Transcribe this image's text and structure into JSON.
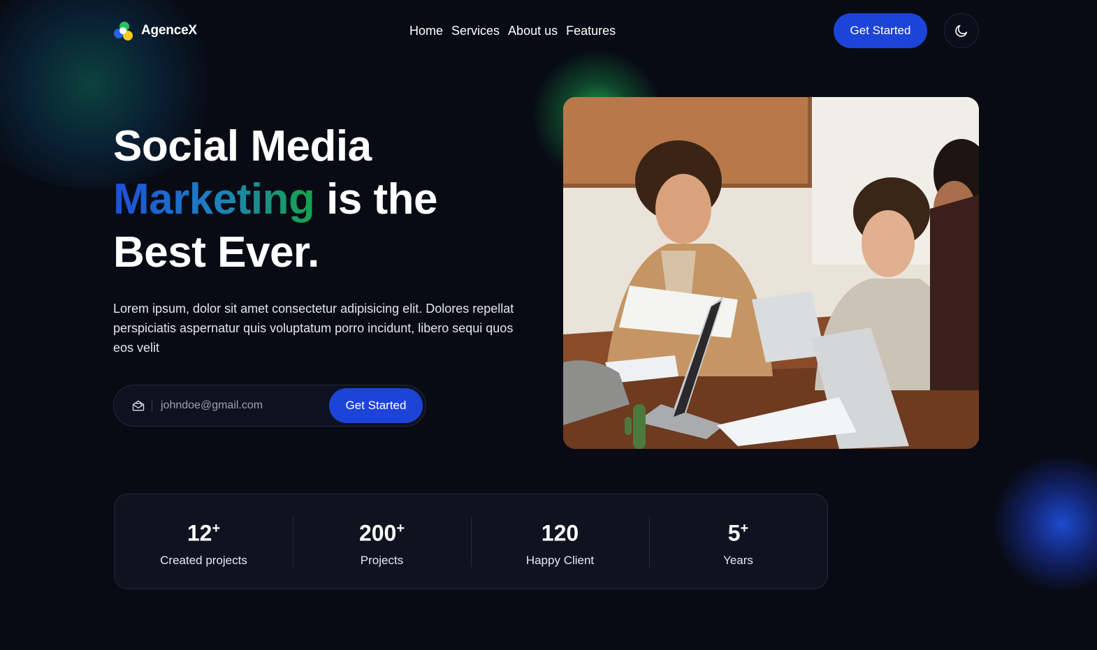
{
  "brand": {
    "name": "AgenceX",
    "colors": {
      "primary": "#1d44d8",
      "gradient_start": "#1d4ed8",
      "gradient_end": "#16a34a",
      "background": "#080b14"
    }
  },
  "nav": {
    "items": [
      {
        "label": "Home"
      },
      {
        "label": "Services"
      },
      {
        "label": "About us"
      },
      {
        "label": "Features"
      }
    ]
  },
  "header": {
    "cta_label": "Get Started",
    "theme_toggle_icon": "moon-icon"
  },
  "hero": {
    "title_line1": "Social Media",
    "title_highlight": "Marketing",
    "title_line2_rest": "is the",
    "title_line3": "Best Ever.",
    "description": "Lorem ipsum, dolor sit amet consectetur adipisicing elit. Dolores repellat perspiciatis aspernatur quis voluptatum porro incidunt, libero sequi quos eos velit",
    "email_placeholder": "johndoe@gmail.com",
    "email_icon": "mail-open-icon",
    "cta_label": "Get Started",
    "image_icon": "team-meeting-photo"
  },
  "stats": [
    {
      "value": "12",
      "suffix": "+",
      "label": "Created projects"
    },
    {
      "value": "200",
      "suffix": "+",
      "label": "Projects"
    },
    {
      "value": "120",
      "suffix": "",
      "label": "Happy Client"
    },
    {
      "value": "5",
      "suffix": "+",
      "label": "Years"
    }
  ]
}
